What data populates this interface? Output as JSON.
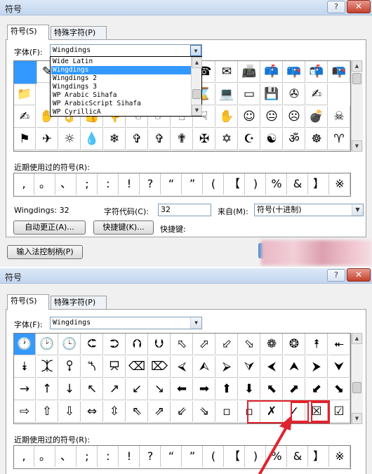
{
  "dialog": {
    "title": "符号",
    "help": "?",
    "close": "✕",
    "tabs": [
      "符号(S)",
      "特殊字符(P)"
    ]
  },
  "font_label": "字体(F):",
  "font_value": "Wingdings",
  "dropdown_options": [
    "Wide Latin",
    "Wingdings",
    "Wingdings 2",
    "Wingdings 3",
    "WP Arabic Sihafa",
    "WP ArabicScript Sihafa",
    "WP CyrillicA"
  ],
  "dropdown_selected": "Wingdings",
  "grid1": {
    "row1": [
      "",
      "✎",
      "",
      "",
      "",
      "",
      "",
      "",
      "☎",
      "✉",
      "📠",
      "📫",
      "📪",
      "📬",
      "📭"
    ],
    "row2": [
      "",
      "📁",
      "",
      "",
      "",
      "",
      "",
      "",
      "⌛",
      "💻",
      "▭",
      "💾",
      "✇",
      "✍"
    ],
    "row3": [
      "✍",
      "✋",
      "👌",
      "👍",
      "👎",
      "☜",
      "☞",
      "☝",
      "☟",
      "✋",
      "☺",
      "😐",
      "☹",
      "💣",
      "☠",
      "⚐"
    ],
    "row4": [
      "⚑",
      "✈",
      "☼",
      "💧",
      "❄",
      "✞",
      "✞",
      "✟",
      "✠",
      "✡",
      "☪",
      "☯",
      "ॐ",
      "☸",
      "♈",
      "♉"
    ]
  },
  "recent_label": "近期使用过的符号(R):",
  "recent_symbols": [
    ",",
    "。",
    "、",
    ";",
    ":",
    "!",
    "?",
    "“",
    "”",
    "(",
    "【",
    ")",
    "%",
    "&",
    "】",
    "※"
  ],
  "info": {
    "font_code_text": "Wingdings: 32",
    "char_code_label": "字符代码(C):",
    "char_code_value": "32",
    "from_label": "来自(M):",
    "from_value": "符号(十进制)",
    "autocorrect_btn": "自动更正(A)...",
    "shortcut_btn": "快捷键(K)...",
    "shortcut_label": "快捷键:",
    "ime_btn": "输入法控制柄(P)"
  },
  "grid2": {
    "row1": [
      "🕐",
      "🕑",
      "🕒",
      "⮈",
      "⮊",
      "⮉",
      "⮋",
      "⬁",
      "⬀",
      "⬃",
      "⬂",
      "❁",
      "❂",
      "⯭",
      "⯬",
      "⯮"
    ],
    "row2": [
      "⯯",
      "⯰",
      "⯱",
      "⯲",
      "⯳",
      "⌫",
      "⌦",
      "⮘",
      "⮙",
      "⮚",
      "⮛",
      "⮜",
      "⮝",
      "⮞",
      "⮟",
      "←"
    ],
    "row3": [
      "→",
      "↑",
      "↓",
      "↖",
      "↗",
      "↙",
      "↘",
      "⬅",
      "➡",
      "⬆",
      "⬇",
      "⬉",
      "⬈",
      "⬋",
      "⬊",
      "⇦"
    ],
    "row4": [
      "⇨",
      "⇧",
      "⇩",
      "⇔",
      "⇳",
      "⇖",
      "⇗",
      "⇙",
      "⇘",
      "▫",
      "▫",
      "✗",
      "✓",
      "☒",
      "☑",
      "⊞"
    ]
  },
  "colors": {
    "selection": "#3399ff",
    "highlight": "#e0232e"
  }
}
